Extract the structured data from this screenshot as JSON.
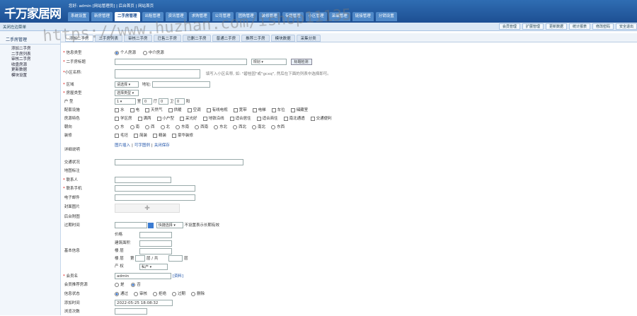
{
  "header": {
    "logo": "千万家居网",
    "welcome": "您好: admin [网站管理员]  |  后台首页 | 网站首页",
    "nav": [
      "系统设置",
      "新房管理",
      "二手房管理",
      "出租管理",
      "资讯管理",
      "求购管理",
      "公司管理",
      "团购管理",
      "装修管理",
      "专题管理",
      "小区管理",
      "采编管理",
      "链接管理",
      "分销设置"
    ],
    "active_nav": "二手房管理"
  },
  "subbar": {
    "collapse": "关闭左边菜单",
    "right_buttons": [
      "会员管理",
      "扩展管理",
      "更新数据",
      "统计报表",
      "修改密码",
      "安全退出"
    ]
  },
  "sidebar": {
    "title": "二手房管理",
    "items": [
      "添加二手房",
      "二手房列表",
      "审核二手房",
      "收盘房源",
      "更新数据",
      "模块设置"
    ]
  },
  "tabs": [
    "添加二手房",
    "二手房列表",
    "审核二手房",
    "已售二手房",
    "已删二手房",
    "普通二手房",
    "推荐二手房",
    "模块数据",
    "采集分类"
  ],
  "form": {
    "info_type": {
      "label": "信息类型",
      "options": [
        "个人房源",
        "中介房源"
      ],
      "selected": 0
    },
    "title": {
      "label": "二手房标题",
      "select": "规划",
      "button": "标题检测"
    },
    "community": {
      "label": "小区名称:",
      "hint": "填写入小区名称, 如: \"碧桂园\"或\"gcxq\", 然后在下面的列表中选择即可。"
    },
    "area": {
      "label": "区域",
      "select": "请选择",
      "address_label": "地址:"
    },
    "house_type": {
      "label": "房屋类型",
      "select": "选择类型"
    },
    "layout": {
      "label": "户 型",
      "rooms": "1",
      "hall_label": "室",
      "hall": "0",
      "bath_label": "厅",
      "bath": "0",
      "bath_unit": "卫",
      "kitchen": "0",
      "kitchen_unit": "阳"
    },
    "facilities": {
      "label": "配套设施",
      "options": [
        "水",
        "电",
        "天然气",
        "供暖",
        "空调",
        "有线电视",
        "宽带",
        "电梯",
        "车位",
        "储藏室"
      ]
    },
    "features": {
      "label": "房源特色",
      "options": [
        "学区房",
        "满两",
        "小户型",
        "采光好",
        "地铁沿线",
        "适合居住",
        "适合商住",
        "南北通透",
        "交通便利"
      ]
    },
    "orientation": {
      "label": "朝向",
      "options": [
        "东",
        "南",
        "西",
        "北",
        "东南",
        "西南",
        "东北",
        "西北",
        "南北",
        "东西"
      ]
    },
    "decoration": {
      "label": "装修",
      "options": [
        "毛坯",
        "简装",
        "精装",
        "豪华装修"
      ]
    },
    "description": {
      "label": "详细说明",
      "links": [
        "图片插入",
        "|",
        "可字图例",
        "|",
        "关闭保存"
      ]
    },
    "traffic": {
      "label": "交通状况"
    },
    "map": {
      "label": "地图标注"
    },
    "contact": {
      "label": "联系人"
    },
    "phone": {
      "label": "联系手机"
    },
    "email": {
      "label": "电子邮件"
    },
    "image": {
      "label": "封面图片"
    },
    "attachment": {
      "label": "后台附图"
    },
    "expire": {
      "label": "过期时间",
      "select": "快捷选择",
      "hint": "不设置表示长期有效"
    },
    "basic_info": {
      "label": "基本信息",
      "price": "价格",
      "building_area": "建筑面积",
      "floor": "楼 层",
      "floor_label": "楼 层",
      "floor_cn": "第",
      "floor_unit": "层 / 共",
      "floor_total": "层",
      "property": "产 权",
      "property_value": "私产"
    },
    "member": {
      "label": "会员名",
      "value": "admin",
      "link": "[资料]"
    },
    "recommend": {
      "label": "会员推荐房源",
      "options": [
        "是",
        "否"
      ],
      "selected": 1
    },
    "status": {
      "label": "信息状态",
      "options": [
        "通过",
        "审核",
        "拒绝",
        "过期",
        "删除"
      ],
      "selected": 0
    },
    "add_time": {
      "label": "添加时间",
      "value": "2022-05-25 18:08:32"
    },
    "views": {
      "label": "浏览次数"
    }
  },
  "watermark": "https://www.huzhan.com/ishop11135"
}
